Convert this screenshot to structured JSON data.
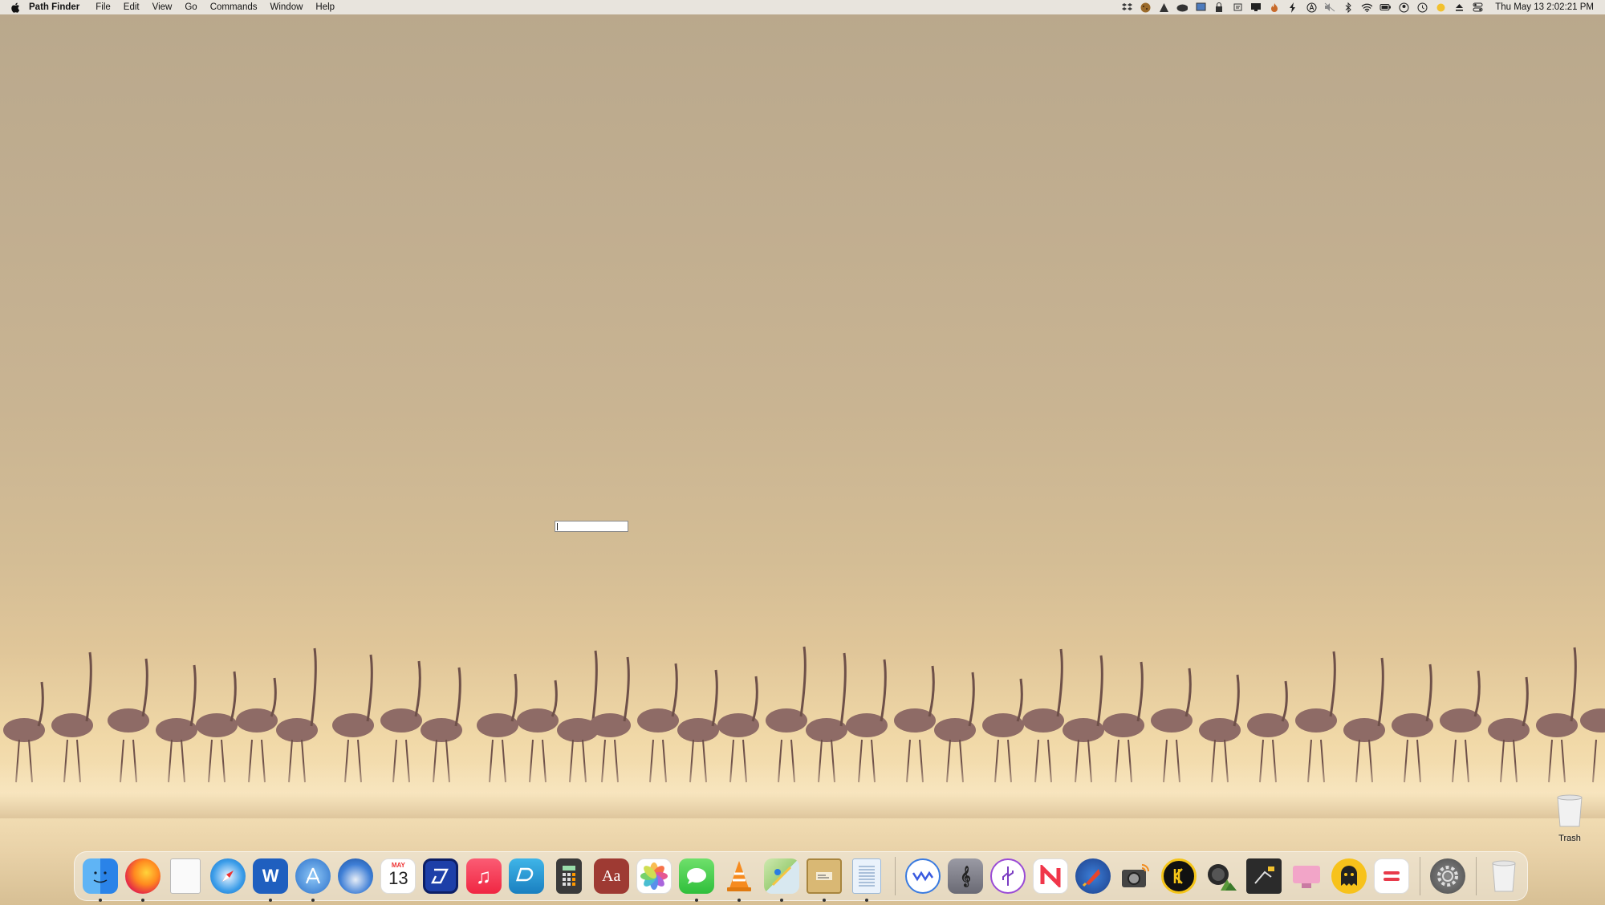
{
  "menubar": {
    "app_name": "Path Finder",
    "menus": [
      "File",
      "Edit",
      "View",
      "Go",
      "Commands",
      "Window",
      "Help"
    ],
    "status_icons": [
      "dropbox-icon",
      "cookie-icon",
      "alfred-icon",
      "cloud-icon",
      "screen-icon",
      "lock-icon",
      "script-icon",
      "display-icon",
      "fire-icon",
      "bolt-icon",
      "a-circle-icon",
      "muted-icon",
      "bluetooth-icon",
      "wifi-icon",
      "battery-icon",
      "user-icon",
      "time-machine-icon",
      "sun-icon",
      "eject-icon",
      "control-center-icon"
    ],
    "clock": "Thu May 13  2:02:21 PM"
  },
  "desktop": {
    "trash_label": "Trash"
  },
  "dock": {
    "calendar_month": "MAY",
    "calendar_day": "13",
    "items": [
      {
        "name": "finder",
        "running": true
      },
      {
        "name": "firefox",
        "running": true
      },
      {
        "name": "preview-file",
        "running": false
      },
      {
        "name": "safari",
        "running": false
      },
      {
        "name": "word",
        "running": true
      },
      {
        "name": "app-store",
        "running": true
      },
      {
        "name": "thunderbird",
        "running": false
      },
      {
        "name": "calendar",
        "running": false
      },
      {
        "name": "scanner",
        "running": false
      },
      {
        "name": "music",
        "running": false
      },
      {
        "name": "dash",
        "running": false
      },
      {
        "name": "calculator",
        "running": false
      },
      {
        "name": "dictionary",
        "running": false
      },
      {
        "name": "photos",
        "running": false
      },
      {
        "name": "messages",
        "running": true
      },
      {
        "name": "vlc",
        "running": true
      },
      {
        "name": "maps",
        "running": true
      },
      {
        "name": "archive",
        "running": true
      },
      {
        "name": "textedit",
        "running": true
      },
      {
        "name": "wave",
        "running": false
      },
      {
        "name": "score",
        "running": false
      },
      {
        "name": "usb",
        "running": false
      },
      {
        "name": "news",
        "running": false
      },
      {
        "name": "rocket",
        "running": false
      },
      {
        "name": "camera",
        "running": false
      },
      {
        "name": "keeper",
        "running": false
      },
      {
        "name": "photo-editor",
        "running": false
      },
      {
        "name": "terminal-pad",
        "running": false
      },
      {
        "name": "cleaner",
        "running": false
      },
      {
        "name": "cyberghost",
        "running": false
      },
      {
        "name": "equals",
        "running": false
      },
      {
        "name": "system-preferences",
        "running": false
      },
      {
        "name": "trash",
        "running": false
      }
    ]
  },
  "colors": {
    "accent": "#1f62c7",
    "menubar_bg": "#ece9e4"
  }
}
